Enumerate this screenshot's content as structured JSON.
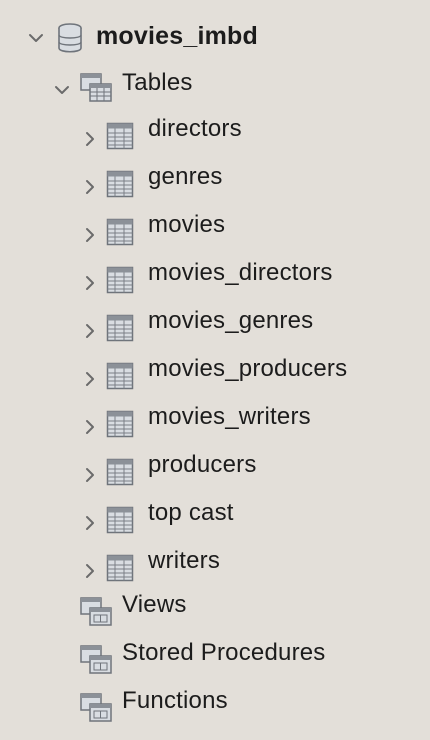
{
  "database": {
    "name": "movies_imbd",
    "expanded": true
  },
  "tables_group": {
    "label": "Tables",
    "expanded": true,
    "items": [
      {
        "label": "directors"
      },
      {
        "label": "genres"
      },
      {
        "label": "movies"
      },
      {
        "label": "movies_directors"
      },
      {
        "label": "movies_genres"
      },
      {
        "label": "movies_producers"
      },
      {
        "label": "movies_writers"
      },
      {
        "label": "producers"
      },
      {
        "label": "top cast"
      },
      {
        "label": "writers"
      }
    ]
  },
  "other_groups": [
    {
      "label": "Views",
      "icon": "views-folder-icon"
    },
    {
      "label": "Stored Procedures",
      "icon": "procedures-folder-icon"
    },
    {
      "label": "Functions",
      "icon": "functions-folder-icon"
    }
  ],
  "colors": {
    "background": "#e3dfd9",
    "text": "#1c1c1c",
    "icon_stroke": "#6f747b",
    "icon_fill": "#d9dde2"
  }
}
